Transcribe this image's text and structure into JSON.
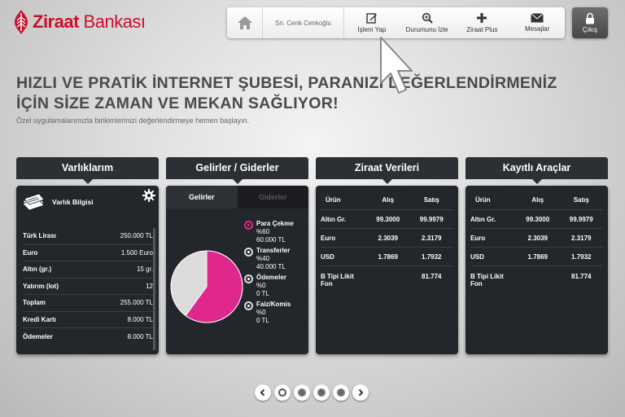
{
  "brand": {
    "name_bold": "Ziraat",
    "name_regular": "Bankası",
    "color": "#c8102e"
  },
  "topnav": {
    "home_icon": "home-icon",
    "user": "Sn. Cenk Cenkoğlu",
    "items": [
      {
        "label": "İşlem Yap",
        "icon": "edit-icon"
      },
      {
        "label": "Durumunu İzle",
        "icon": "search-icon"
      },
      {
        "label": "Ziraat Plus",
        "icon": "plus-icon"
      },
      {
        "label": "Mesajlar",
        "icon": "mail-icon"
      }
    ],
    "logout": "Çıkış"
  },
  "headline": {
    "line1": "HIZLI VE PRATİK İNTERNET ŞUBESİ, PARANIZI DEĞERLENDİRMENİZ",
    "line2": "İÇİN SİZE ZAMAN VE MEKAN SAĞLIYOR!",
    "sub": "Özel uygulamalarımızla birikimlerinizi değerlendirmeye hemen başlayın."
  },
  "assets": {
    "tab": "Varlıklarım",
    "title": "Varlık Bilgisi",
    "rows": [
      {
        "k": "Türk Lirası",
        "v": "250.000 TL"
      },
      {
        "k": "Euro",
        "v": "1.500 Euro"
      },
      {
        "k": "Altın (gr.)",
        "v": "15 gr."
      },
      {
        "k": "Yatırım (lot)",
        "v": "12"
      },
      {
        "k": "Toplam",
        "v": "255.000 TL"
      },
      {
        "k": "Kredi Kartı",
        "v": "8.000 TL"
      },
      {
        "k": "Ödemeler",
        "v": "8.000 TL"
      }
    ]
  },
  "income": {
    "tab": "Gelirler / Giderler",
    "tabs": [
      "Gelirler",
      "Giderler"
    ],
    "legend": [
      {
        "name": "Para Çekme",
        "pct": "%60",
        "amount": "60.000 TL",
        "selected": true
      },
      {
        "name": "Transferler",
        "pct": "%40",
        "amount": "40.000 TL",
        "selected": false
      },
      {
        "name": "Ödemeler",
        "pct": "%0",
        "amount": "0 TL",
        "selected": false
      },
      {
        "name": "Faiz/Komis",
        "pct": "%0",
        "amount": "0 TL",
        "selected": false
      }
    ],
    "pie": {
      "highlight_fraction": 0.6,
      "highlight_color": "#e0288c",
      "rest_color": "#dcdcdc"
    }
  },
  "ziraat_data": {
    "tab": "Ziraat Verileri",
    "headers": [
      "Ürün",
      "Alış",
      "Satış"
    ],
    "rows": [
      [
        "Altın Gr.",
        "99.3000",
        "99.9979"
      ],
      [
        "Euro",
        "2.3039",
        "2.3179"
      ],
      [
        "USD",
        "1.7869",
        "1.7932"
      ],
      [
        "B Tipi Likit Fon",
        "",
        "81.774"
      ]
    ]
  },
  "saved_tools": {
    "tab": "Kayıtlı Araçlar",
    "headers": [
      "Ürün",
      "Alış",
      "Satış"
    ],
    "rows": [
      [
        "Altın Gr.",
        "99.3000",
        "99.9979"
      ],
      [
        "Euro",
        "2.3039",
        "2.3179"
      ],
      [
        "USD",
        "1.7869",
        "1.7932"
      ],
      [
        "B Tipi Likit Fon",
        "",
        "81.774"
      ]
    ]
  },
  "pager": {
    "pages": 5,
    "active": 0
  }
}
